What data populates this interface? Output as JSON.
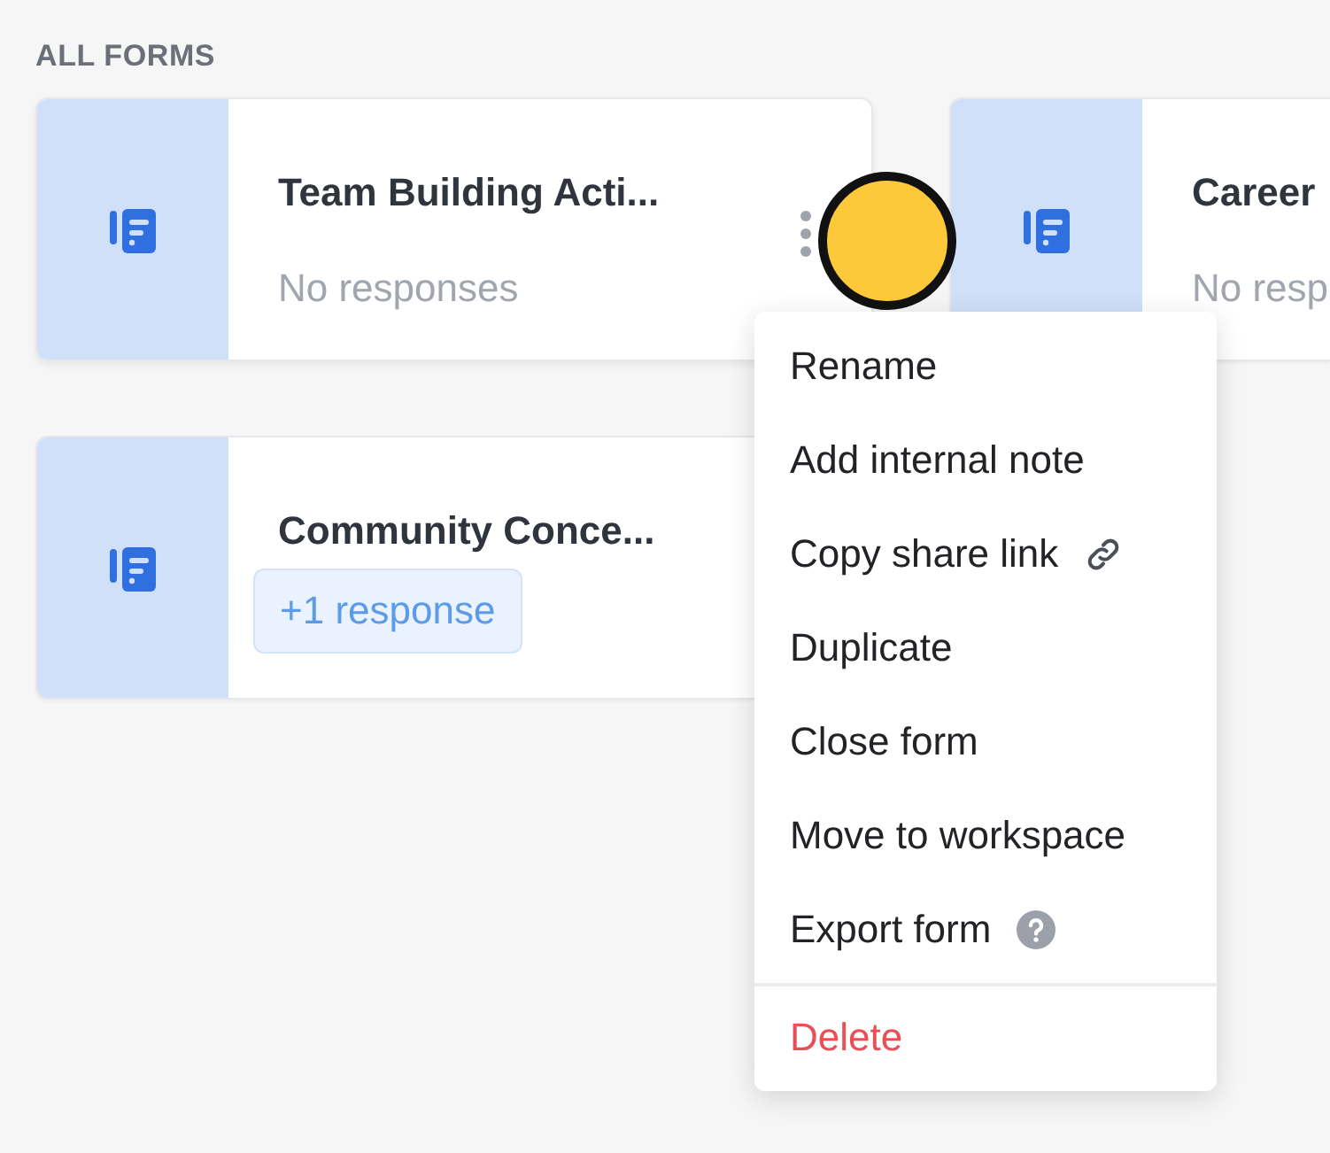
{
  "section_title": "ALL FORMS",
  "forms": [
    {
      "title": "Team Building Acti...",
      "hovered": true,
      "responses": {
        "kind": "muted",
        "text": "No responses"
      }
    },
    {
      "title": "Career",
      "hovered": false,
      "responses": {
        "kind": "muted",
        "text": "No resp"
      }
    },
    {
      "title": "Community Conce...",
      "hovered": false,
      "responses": {
        "kind": "badge",
        "text": "+1 response"
      }
    }
  ],
  "menu": {
    "items": [
      {
        "label": "Rename",
        "kind": "plain"
      },
      {
        "label": "Add internal note",
        "kind": "plain"
      },
      {
        "label": "Copy share link",
        "kind": "link"
      },
      {
        "label": "Duplicate",
        "kind": "plain"
      },
      {
        "label": "Close form",
        "kind": "plain"
      },
      {
        "label": "Move to workspace",
        "kind": "plain"
      },
      {
        "label": "Export form",
        "kind": "help"
      },
      {
        "label": "Delete",
        "kind": "danger"
      }
    ]
  }
}
